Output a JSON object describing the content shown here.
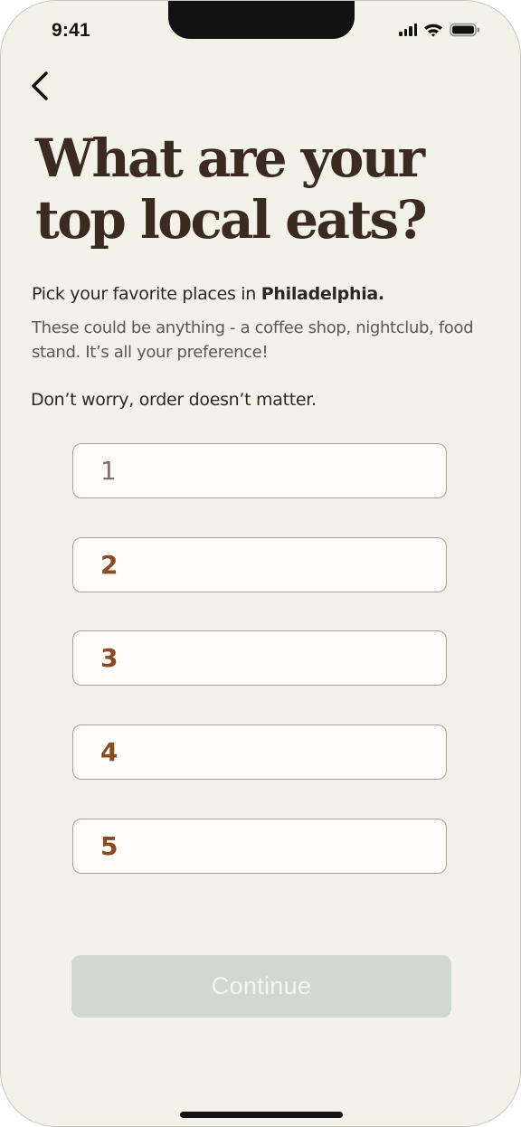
{
  "status_bar": {
    "time": "9:41",
    "icons": [
      "cellular-signal-icon",
      "wifi-icon",
      "battery-icon"
    ]
  },
  "nav": {
    "back_icon": "chevron-left-icon"
  },
  "header": {
    "title_line1": "What are your",
    "title_line2": "top local eats?"
  },
  "intro": {
    "pick_prefix": "Pick your favorite places in ",
    "city": "Philadelphia.",
    "description": "These could be anything - a coffee shop, nightclub, food stand. It’s all your preference!",
    "note": "Don’t worry, order doesn’t matter."
  },
  "fields": [
    {
      "number": "1",
      "value": "",
      "state": "focused"
    },
    {
      "number": "2",
      "value": ""
    },
    {
      "number": "3",
      "value": ""
    },
    {
      "number": "4",
      "value": ""
    },
    {
      "number": "5",
      "value": ""
    }
  ],
  "actions": {
    "continue_label": "Continue",
    "continue_enabled": false
  },
  "colors": {
    "background": "#f3f2e8",
    "title": "#3a2a22",
    "accent_number": "#8a4a22",
    "button_disabled": "#cfd9cd"
  }
}
